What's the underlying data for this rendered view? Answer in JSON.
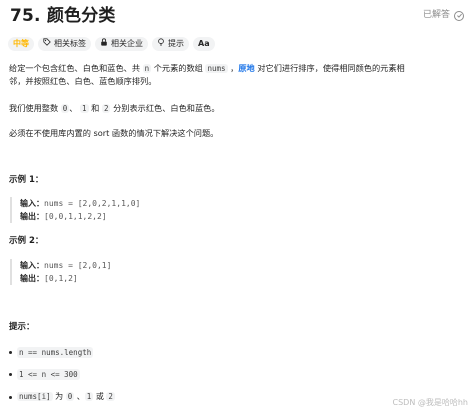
{
  "title": "75. 颜色分类",
  "solved_label": "已解答",
  "tags": {
    "difficulty": "中等",
    "related_tags": "相关标签",
    "related_companies": "相关企业",
    "hint": "提示",
    "font_toggle": "Aa"
  },
  "description": {
    "p1_a": "给定一个包含红色、白色和蓝色、共 ",
    "p1_n": "n",
    "p1_b": " 个元素的数组 ",
    "p1_nums": "nums",
    "p1_c": " ，",
    "p1_link": "原地",
    "p1_d": " 对它们进行排序，使得相同颜色的元素相",
    "p1_line2": "邻，并按照红色、白色、蓝色顺序排列。",
    "p2_a": "我们使用整数 ",
    "p2_0": "0",
    "p2_b": "、 ",
    "p2_1": "1",
    "p2_c": " 和 ",
    "p2_2": "2",
    "p2_d": " 分别表示红色、白色和蓝色。",
    "p3": "必须在不使用库内置的 sort 函数的情况下解决这个问题。"
  },
  "example1": {
    "heading": "示例 1：",
    "input_label": "输入：",
    "input_value": "nums = [2,0,2,1,1,0]",
    "output_label": "输出：",
    "output_value": "[0,0,1,1,2,2]"
  },
  "example2": {
    "heading": "示例 2：",
    "input_label": "输入：",
    "input_value": "nums = [2,0,1]",
    "output_label": "输出：",
    "output_value": "[0,1,2]"
  },
  "constraints": {
    "heading": "提示：",
    "item1": "n == nums.length",
    "item2": "1 <= n <= 300",
    "item3_code": "nums[i]",
    "item3_text": " 为 ",
    "item3_0": "0",
    "item3_sep1": " 、",
    "item3_1": "1",
    "item3_or": " 或 ",
    "item3_2": "2"
  },
  "watermark": "CSDN @我是哈哈hh",
  "colors": {
    "difficulty_medium": "#ffb800",
    "link": "#1a73e8",
    "tag_bg": "#f2f3f4"
  }
}
